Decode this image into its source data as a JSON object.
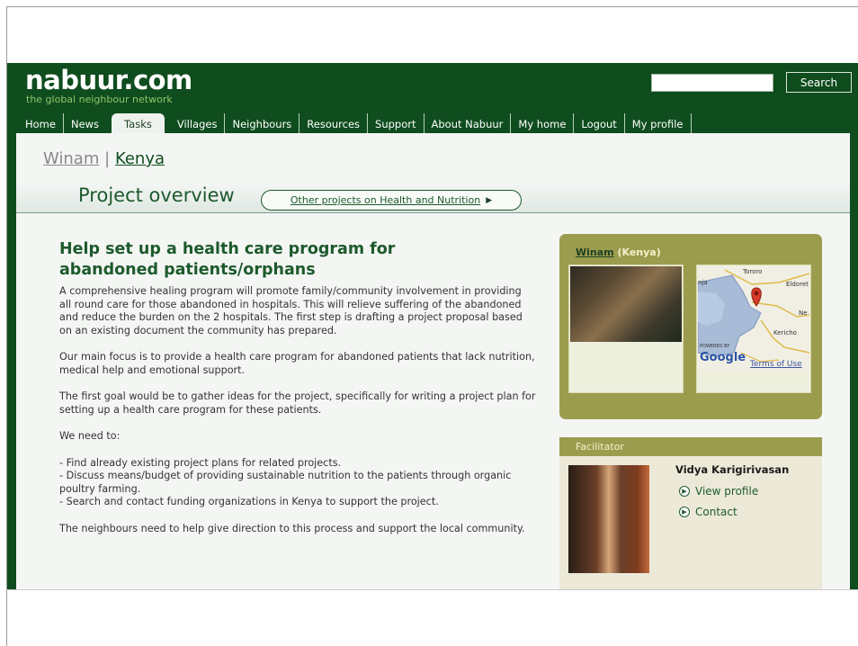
{
  "header": {
    "logo": "nabuur.com",
    "tagline": "the global neighbour network",
    "search_placeholder": "",
    "search_button": "Search"
  },
  "nav": [
    "Home",
    "News",
    "Tasks",
    "Villages",
    "Neighbours",
    "Resources",
    "Support",
    "About Nabuur",
    "My home",
    "Logout",
    "My profile"
  ],
  "nav_active": "Tasks",
  "breadcrumb": {
    "village": "Winam",
    "separator": "|",
    "country": "Kenya"
  },
  "band": {
    "title": "Project overview",
    "link": "Other projects on Health and Nutrition"
  },
  "project": {
    "headline": "Help set up a health care program for abandoned patients/orphans",
    "paragraphs": [
      "A comprehensive healing program will promote family/community involvement in providing all round care for those abandoned in hospitals. This will relieve suffering of the abandoned and reduce the burden on the 2 hospitals. The first step is drafting a project proposal based on an existing document the community has prepared.",
      "Our main focus is to provide a health care program for abandoned patients that lack nutrition, medical help and emotional support.",
      "The first goal would be to gather ideas for the project, specifically for writing a project plan for setting up a health care program for these patients.",
      "We need to:",
      "- Find already existing project plans for related projects.\n- Discuss means/budget of providing sustainable nutrition to the patients through organic poultry farming.\n- Search and contact funding organizations in Kenya to support the project.",
      "The neighbours need to help give direction to this process and support the local community."
    ]
  },
  "village_box": {
    "village": "Winam",
    "country": "(Kenya)",
    "map_labels": [
      "Tororo",
      "Eldoret",
      "Ne",
      "Kericho",
      "nja"
    ],
    "map_attrib": "POWERED BY",
    "map_logo": "Google",
    "terms": "Terms of Use"
  },
  "facilitator": {
    "header": "Facilitator",
    "name": "Vidya Karigirivasan",
    "view_profile": "View profile",
    "contact": "Contact"
  },
  "colors": {
    "dark_green": "#0f4d1e",
    "olive": "#9c9c4f",
    "page_bg": "#f4f6f4"
  }
}
